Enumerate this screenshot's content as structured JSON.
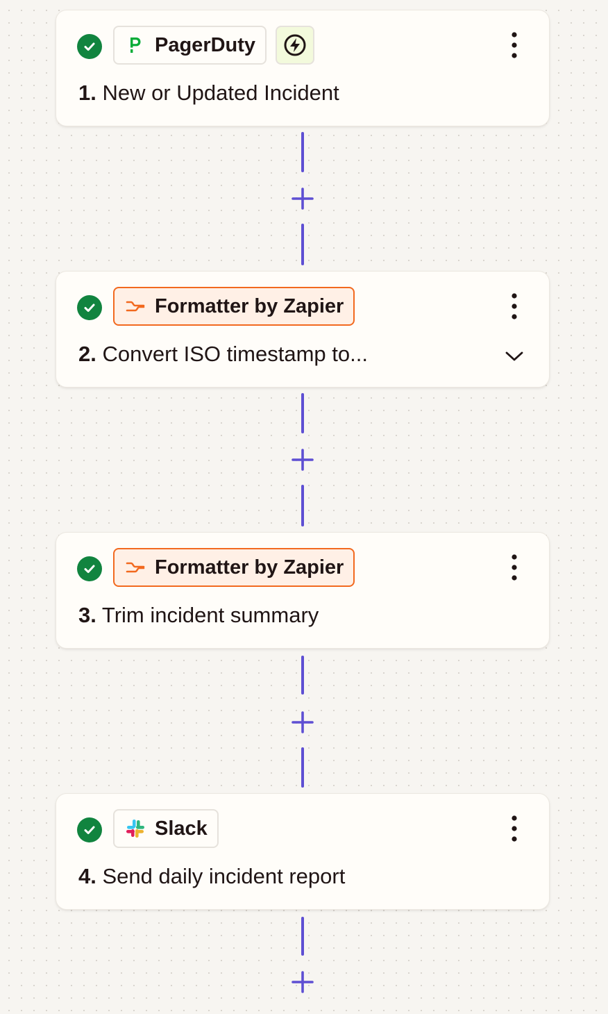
{
  "colors": {
    "success_green": "#11843f",
    "connector_purple": "#5e4fd3",
    "formatter_orange": "#f2691f",
    "formatter_bg": "#fff0e6",
    "trigger_bg": "#f3fadc",
    "pagerduty_green": "#06ac38"
  },
  "steps": [
    {
      "number": "1.",
      "title": "New or Updated Incident",
      "app": "PagerDuty",
      "app_icon": "pagerduty-logo-icon",
      "status_icon": "check-circle-icon",
      "trigger_icon": "lightning-bolt-icon",
      "menu_icon": "more-vertical-icon"
    },
    {
      "number": "2.",
      "title": "Convert ISO timestamp to...",
      "app": "Formatter by Zapier",
      "app_icon": "formatter-icon",
      "status_icon": "check-circle-icon",
      "menu_icon": "more-vertical-icon",
      "expand_icon": "chevron-down-icon"
    },
    {
      "number": "3.",
      "title": "Trim incident summary",
      "app": "Formatter by Zapier",
      "app_icon": "formatter-icon",
      "status_icon": "check-circle-icon",
      "menu_icon": "more-vertical-icon"
    },
    {
      "number": "4.",
      "title": "Send daily incident report",
      "app": "Slack",
      "app_icon": "slack-logo-icon",
      "status_icon": "check-circle-icon",
      "menu_icon": "more-vertical-icon"
    }
  ],
  "connector": {
    "add_icon": "plus-icon"
  }
}
